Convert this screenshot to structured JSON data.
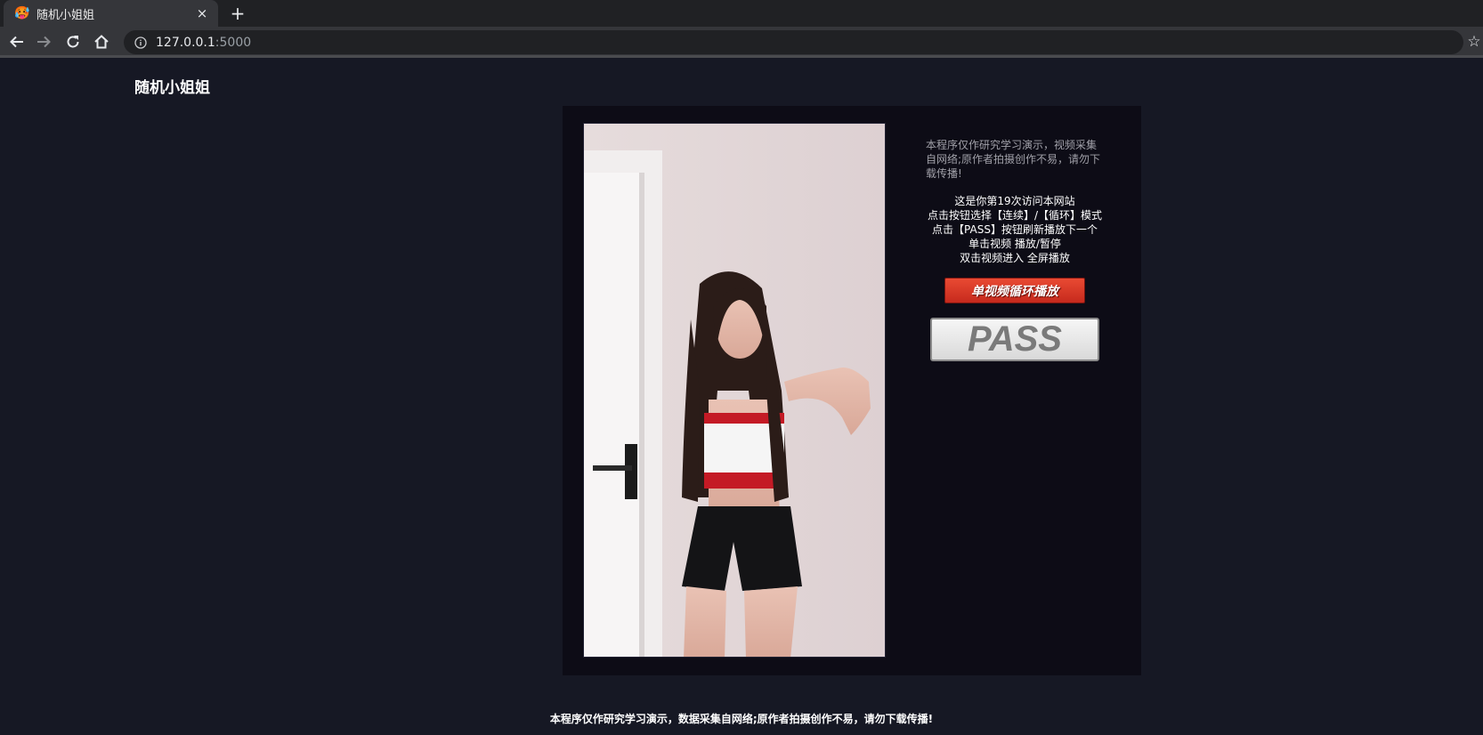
{
  "browser": {
    "tab_title": "随机小姐姐",
    "favicon": "🥵",
    "close_label": "×",
    "newtab_label": "+",
    "url_host": "127.0.0.1",
    "url_port": ":5000"
  },
  "page": {
    "site_title": "随机小姐姐",
    "disclaimer": "本程序仅作研究学习演示，视频采集自网络;原作者拍摄创作不易，请勿下载传播!",
    "info_lines": [
      "这是你第19次访问本网站",
      "点击按钮选择【连续】/【循环】模式",
      "点击【PASS】按钮刷新播放下一个",
      "单击视频 播放/暂停",
      "双击视频进入 全屏播放"
    ],
    "loop_button_label": "单视频循环播放",
    "pass_button_label": "PASS",
    "footer": "本程序仅作研究学习演示，数据采集自网络;原作者拍摄创作不易，请勿下载传播!"
  },
  "colors": {
    "page_bg": "#161824",
    "card_bg": "#0d0c16",
    "loop_button": "#d8341f",
    "pass_button_text": "#7a7a7a"
  }
}
